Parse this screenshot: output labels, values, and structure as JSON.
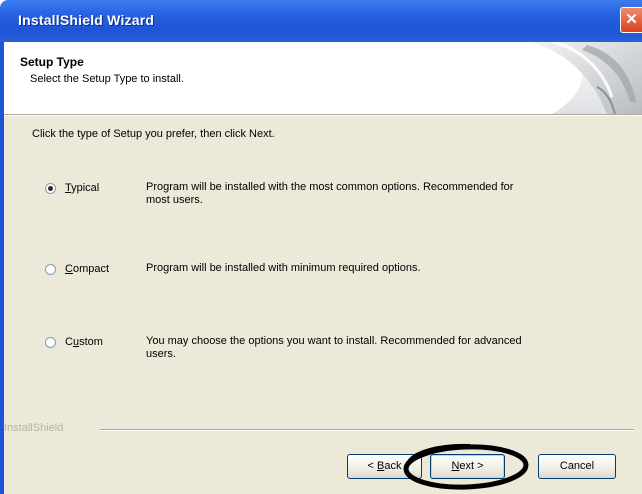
{
  "window": {
    "title": "InstallShield Wizard",
    "close_glyph": "✕"
  },
  "header": {
    "title": "Setup Type",
    "subtitle": "Select the Setup Type to install."
  },
  "instruction": "Click the type of Setup you prefer, then click Next.",
  "options": [
    {
      "label_accel": "T",
      "label_rest": "ypical",
      "selected": true,
      "description_line1": "Program will be installed with the most common options.  Recommended for",
      "description_line2": "most users."
    },
    {
      "label_accel": "C",
      "label_rest": "ompact",
      "selected": false,
      "description_line1": "Program will be installed with minimum required options.",
      "description_line2": ""
    },
    {
      "label_pre": "C",
      "label_accel": "u",
      "label_rest": "stom",
      "selected": false,
      "description_line1": "You may choose the options you want to install. Recommended for advanced",
      "description_line2": "users."
    }
  ],
  "brand": "InstallShield",
  "buttons": {
    "back_pre": "< ",
    "back_accel": "B",
    "back_rest": "ack",
    "next_accel": "N",
    "next_rest": "ext >",
    "cancel": "Cancel"
  },
  "colors": {
    "titlebar": "#2762e0",
    "dialog_bg": "#ece9d8",
    "annotation": "#000000"
  }
}
